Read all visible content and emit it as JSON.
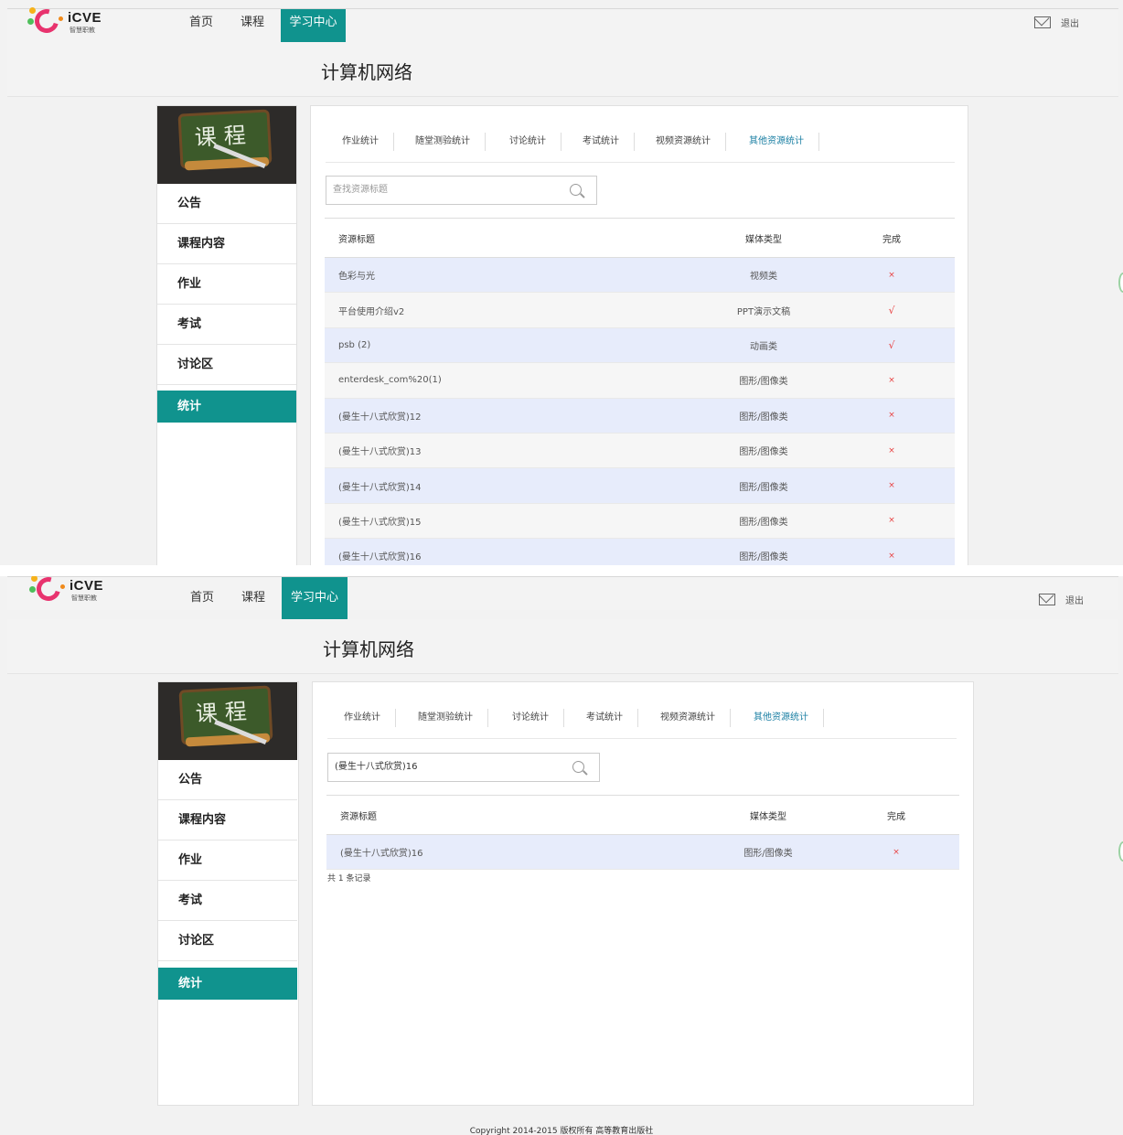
{
  "logo": {
    "word": "iCVE",
    "sub": "智慧职教"
  },
  "nav": {
    "home": "首页",
    "courses": "课程",
    "study_center": "学习中心",
    "logout": "退出"
  },
  "course_title": "计算机网络",
  "sidebar": {
    "image_text": "课程",
    "items": [
      "公告",
      "课程内容",
      "作业",
      "考试",
      "讨论区",
      "统计"
    ]
  },
  "tabs": [
    "作业统计",
    "随堂测验统计",
    "讨论统计",
    "考试统计",
    "视频资源统计",
    "其他资源统计"
  ],
  "columns": {
    "title": "资源标题",
    "media_type": "媒体类型",
    "done": "完成"
  },
  "view1": {
    "search_placeholder": "查找资源标题",
    "rows": [
      {
        "title": "色彩与光",
        "type": "视频类",
        "done": "×"
      },
      {
        "title": "平台使用介绍v2",
        "type": "PPT演示文稿",
        "done": "√"
      },
      {
        "title": "psb (2)",
        "type": "动画类",
        "done": "√"
      },
      {
        "title": "enterdesk_com%20(1)",
        "type": "图形/图像类",
        "done": "×"
      },
      {
        "title": "(曼生十八式欣赏)12",
        "type": "图形/图像类",
        "done": "×"
      },
      {
        "title": "(曼生十八式欣赏)13",
        "type": "图形/图像类",
        "done": "×"
      },
      {
        "title": "(曼生十八式欣赏)14",
        "type": "图形/图像类",
        "done": "×"
      },
      {
        "title": "(曼生十八式欣赏)15",
        "type": "图形/图像类",
        "done": "×"
      },
      {
        "title": "(曼生十八式欣赏)16",
        "type": "图形/图像类",
        "done": "×"
      }
    ]
  },
  "view2": {
    "search_value": "(曼生十八式欣赏)16",
    "rows": [
      {
        "title": "(曼生十八式欣赏)16",
        "type": "图形/图像类",
        "done": "×"
      }
    ],
    "total": "共 1 条记录"
  },
  "footer": "Copyright 2014-2015 版权所有 高等教育出版社",
  "colors": {
    "accent": "#10938e",
    "row_highlight": "#e7ecfb",
    "mark": "#e84040",
    "active_tab": "#1a7fa3"
  }
}
